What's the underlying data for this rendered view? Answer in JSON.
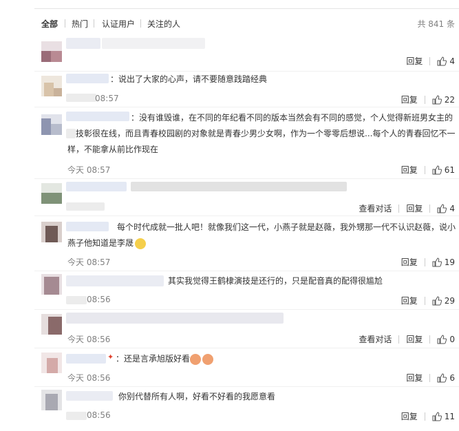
{
  "tabs": {
    "items": [
      "全部",
      "热门",
      "认证用户",
      "关注的人"
    ],
    "total": "共 841 条"
  },
  "labels": {
    "reply": "回复",
    "view_conversation": "查看对话"
  },
  "colors": {
    "text": "#333333",
    "meta": "#808080",
    "divider": "#f0f0f0"
  },
  "comments": [
    {
      "text": "",
      "time": "",
      "likes": "4"
    },
    {
      "text": "：说出了大家的心声，请不要随意践踏经典",
      "time": "08:57",
      "likes": "22"
    },
    {
      "text_line1": "：没有谁毁谁，在不同的年纪看不同的版本当然会有不同的感觉，个人觉得新班男女主的",
      "text_line2": "技彰很在线，而且青春校园剧的对象就是青春少男少女啊，作为一个零零后想说...每个人的青春回忆不一",
      "text_line3": "样，不能拿从前比作现在",
      "time": "今天 08:57",
      "likes": "61"
    },
    {
      "text": "",
      "time": "",
      "likes": "4"
    },
    {
      "text_line1": "每个时代成就一批人吧！就像我们这一代，小燕子就是赵薇，我外甥那一代不认识赵薇，说小",
      "text_line2": "燕子他知道是李晟",
      "time": "今天 08:57",
      "likes": "19"
    },
    {
      "text": "其实我觉得王鹤棣演技是还行的，只是配音真的配得很尴尬",
      "time": "08:56",
      "likes": "29"
    },
    {
      "text": "",
      "time": "今天 08:56",
      "likes": "0"
    },
    {
      "text": "：还是言承旭版好看",
      "time": "今天 08:56",
      "likes": "6"
    },
    {
      "text": "你别代替所有人啊，好看不好看的我愿意看",
      "time": "08:56",
      "likes": "11"
    }
  ]
}
